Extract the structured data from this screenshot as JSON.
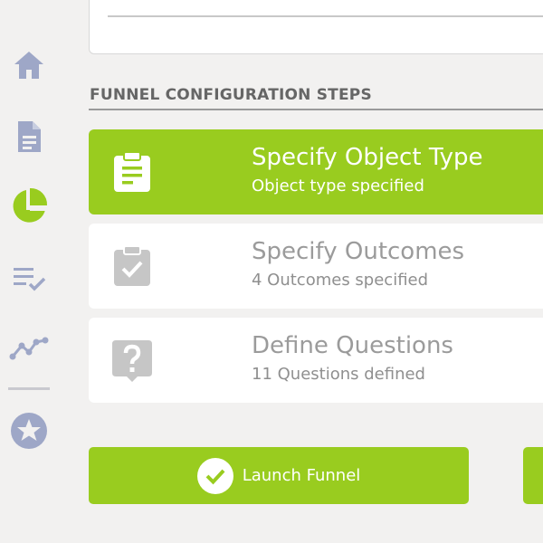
{
  "sidebar": {
    "items": [
      {
        "icon": "home-icon"
      },
      {
        "icon": "document-icon"
      },
      {
        "icon": "pie-chart-icon",
        "active": true
      },
      {
        "icon": "checklist-icon"
      },
      {
        "icon": "trend-line-icon"
      },
      {
        "icon": "star-icon"
      }
    ]
  },
  "section": {
    "title": "FUNNEL CONFIGURATION STEPS"
  },
  "steps": [
    {
      "title": "Specify Object Type",
      "subtitle": "Object type specified",
      "icon": "clipboard-list-icon",
      "active": true
    },
    {
      "title": "Specify Outcomes",
      "subtitle": "4 Outcomes specified",
      "icon": "clipboard-check-icon",
      "active": false
    },
    {
      "title": "Define Questions",
      "subtitle": "11 Questions defined",
      "icon": "question-icon",
      "active": false
    }
  ],
  "actions": {
    "launch_label": "Launch Funnel"
  },
  "colors": {
    "accent": "#99cc1f",
    "sidebar_icon": "#9ea7c7",
    "inactive_icon": "#c6c6c6",
    "background": "#f2f1f0"
  }
}
